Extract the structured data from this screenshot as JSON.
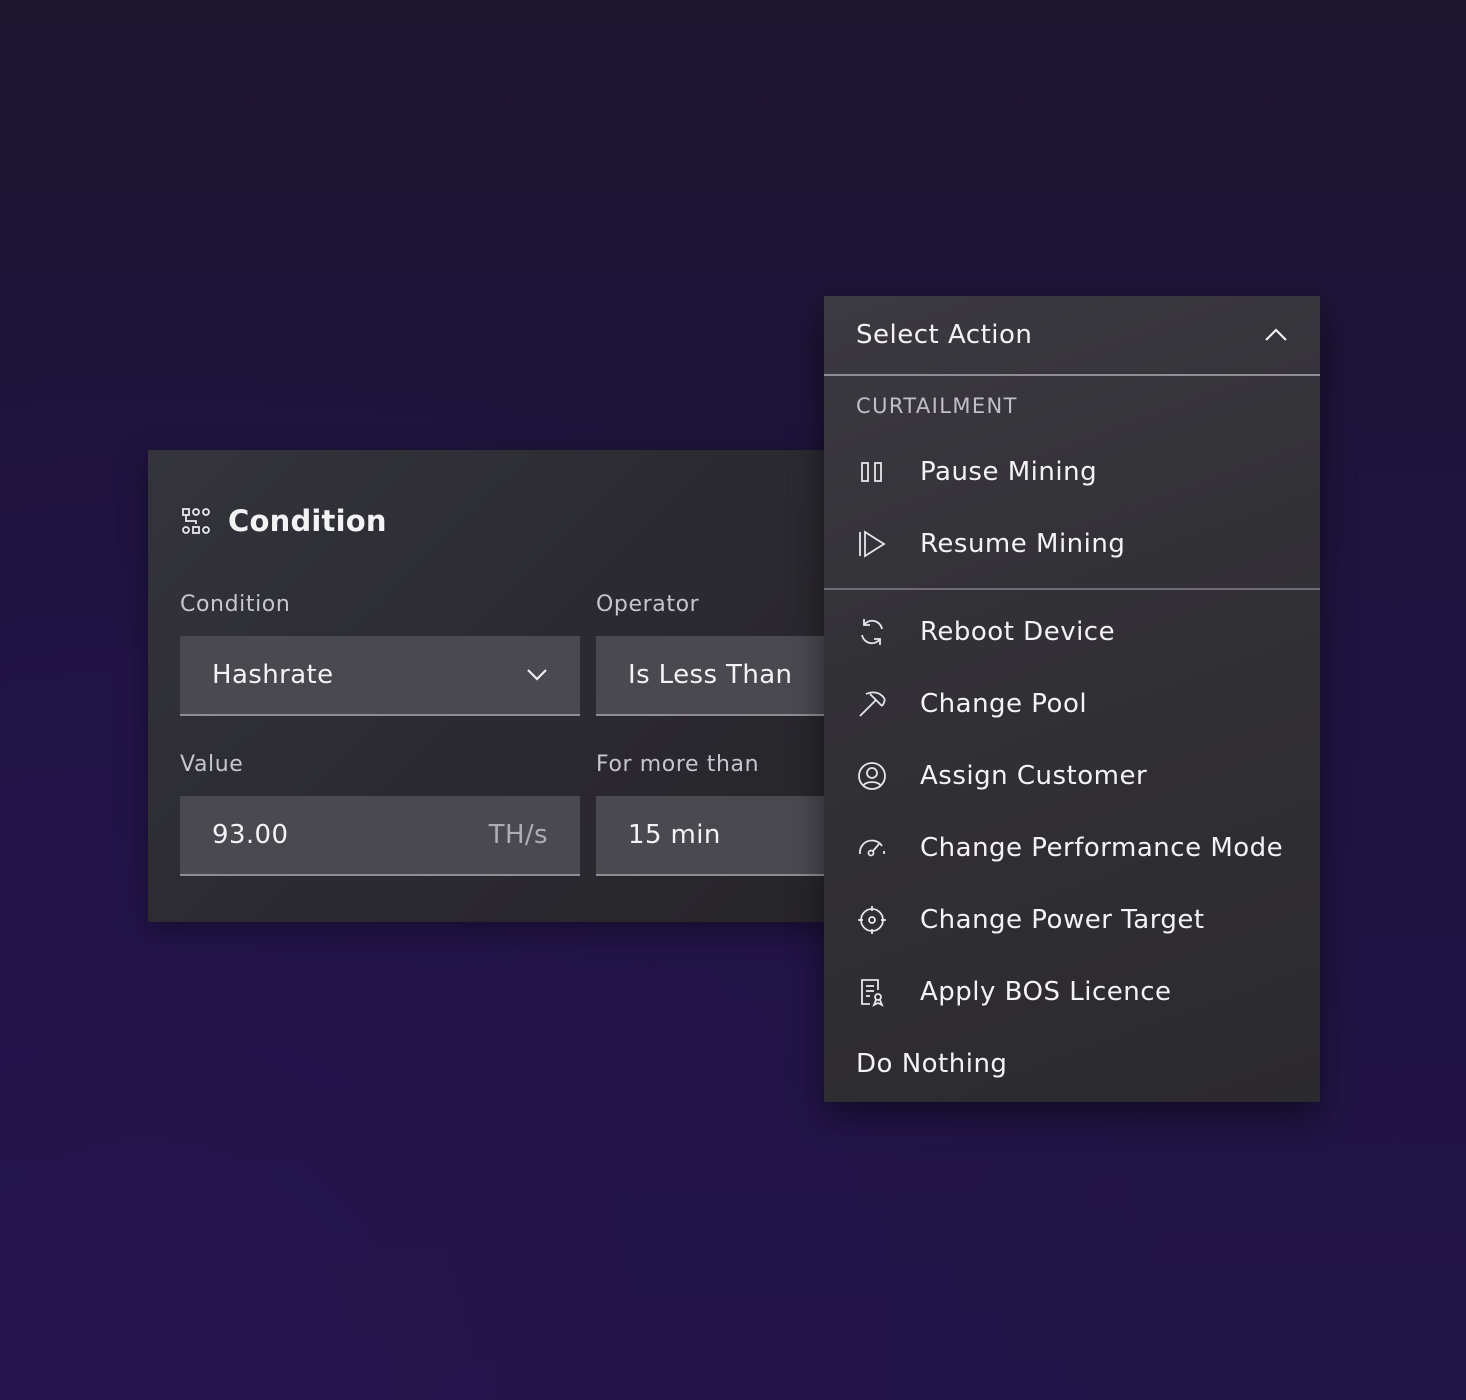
{
  "condition_card": {
    "title": "Condition",
    "title_icon": "condition-flow-icon",
    "condition": {
      "label": "Condition",
      "value": "Hashrate",
      "icon": "chevron-down-icon"
    },
    "operator": {
      "label": "Operator",
      "value": "Is Less Than"
    },
    "value": {
      "label": "Value",
      "value": "93.00",
      "unit": "TH/s"
    },
    "duration": {
      "label": "For more than",
      "value": "15 min"
    }
  },
  "action_dropdown": {
    "placeholder": "Select Action",
    "toggle_icon": "chevron-up-icon",
    "groups": [
      {
        "label": "CURTAILMENT",
        "items": [
          {
            "label": "Pause Mining",
            "icon": "pause-icon"
          },
          {
            "label": "Resume Mining",
            "icon": "play-icon"
          }
        ]
      },
      {
        "label": "",
        "items": [
          {
            "label": "Reboot Device",
            "icon": "reboot-icon"
          },
          {
            "label": "Change Pool",
            "icon": "pickaxe-icon"
          },
          {
            "label": "Assign Customer",
            "icon": "user-avatar-icon"
          },
          {
            "label": "Change Performance Mode",
            "icon": "speedometer-icon"
          },
          {
            "label": "Change Power Target",
            "icon": "target-icon"
          },
          {
            "label": "Apply BOS Licence",
            "icon": "licence-document-icon"
          },
          {
            "label": "Do Nothing",
            "icon": ""
          }
        ]
      }
    ]
  },
  "colors": {
    "background": "#1f1441",
    "card": "#2f2e34",
    "field": "#4a4950",
    "text": "#f3f3f5",
    "muted_text": "#c7c6cc"
  }
}
